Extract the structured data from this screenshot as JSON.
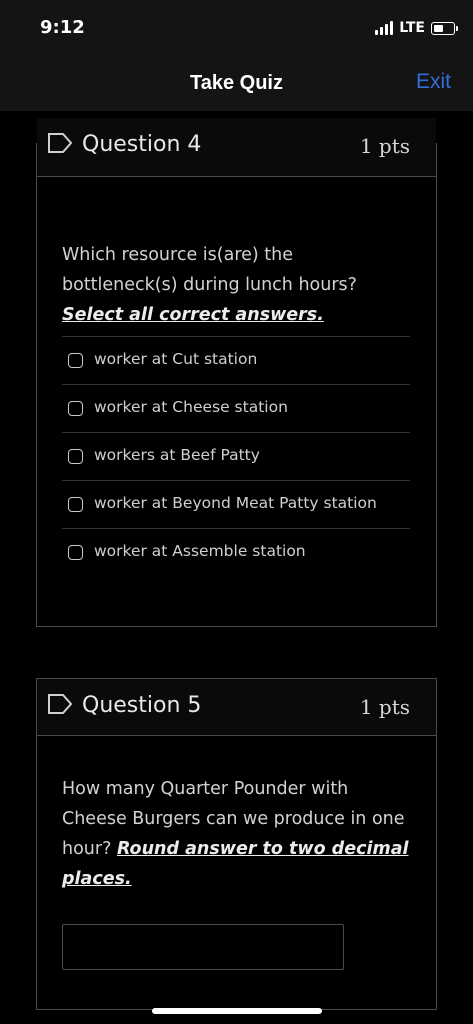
{
  "status": {
    "time": "9:12",
    "network": "LTE"
  },
  "nav": {
    "title": "Take Quiz",
    "exit_label": "Exit"
  },
  "question4": {
    "title": "Question 4",
    "points": "1 pts",
    "text": "Which resource is(are) the bottleneck(s) during lunch hours?",
    "instruction": "Select all correct answers.",
    "answers": [
      "worker at Cut station",
      "worker at Cheese station",
      "workers at Beef Patty",
      "worker at Beyond Meat Patty station",
      "worker at Assemble station"
    ]
  },
  "question5": {
    "title": "Question 5",
    "points": "1 pts",
    "text": "How many Quarter Pounder with Cheese Burgers can we produce in one hour?",
    "instruction": "Round answer to two decimal places.",
    "answer_value": ""
  },
  "colors": {
    "accent": "#2f6fd6",
    "background": "#000000",
    "border": "#4a4a4a"
  }
}
